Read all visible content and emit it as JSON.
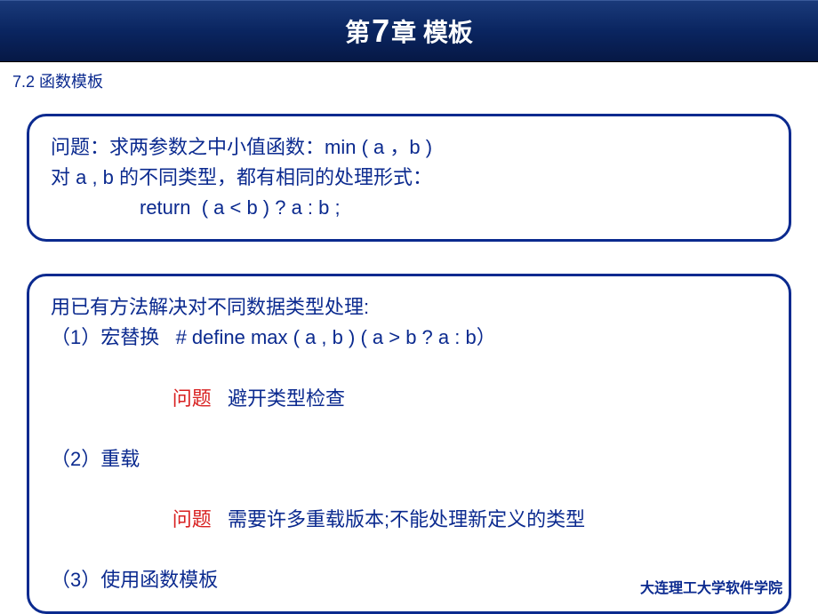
{
  "title": {
    "prefix": "第",
    "number": "7",
    "suffix": "章 模板"
  },
  "section": "7.2 函数模板",
  "box1": {
    "line1": "问题：求两参数之中小值函数：min ( a ，b )",
    "line2": "对 a , b 的不同类型，都有相同的处理形式：",
    "line3": "return  ( a < b ) ? a : b ;"
  },
  "box2": {
    "heading": "用已有方法解决对不同数据类型处理:",
    "item1": "（1）宏替换   # define max ( a , b ) ( a > b ? a : b）",
    "item1_problem_label": "问题",
    "item1_problem_text": "避开类型检查",
    "item2": "（2）重载",
    "item2_problem_label": "问题",
    "item2_problem_text": "需要许多重载版本;不能处理新定义的类型",
    "item3": "（3）使用函数模板"
  },
  "footer": "大连理工大学软件学院"
}
